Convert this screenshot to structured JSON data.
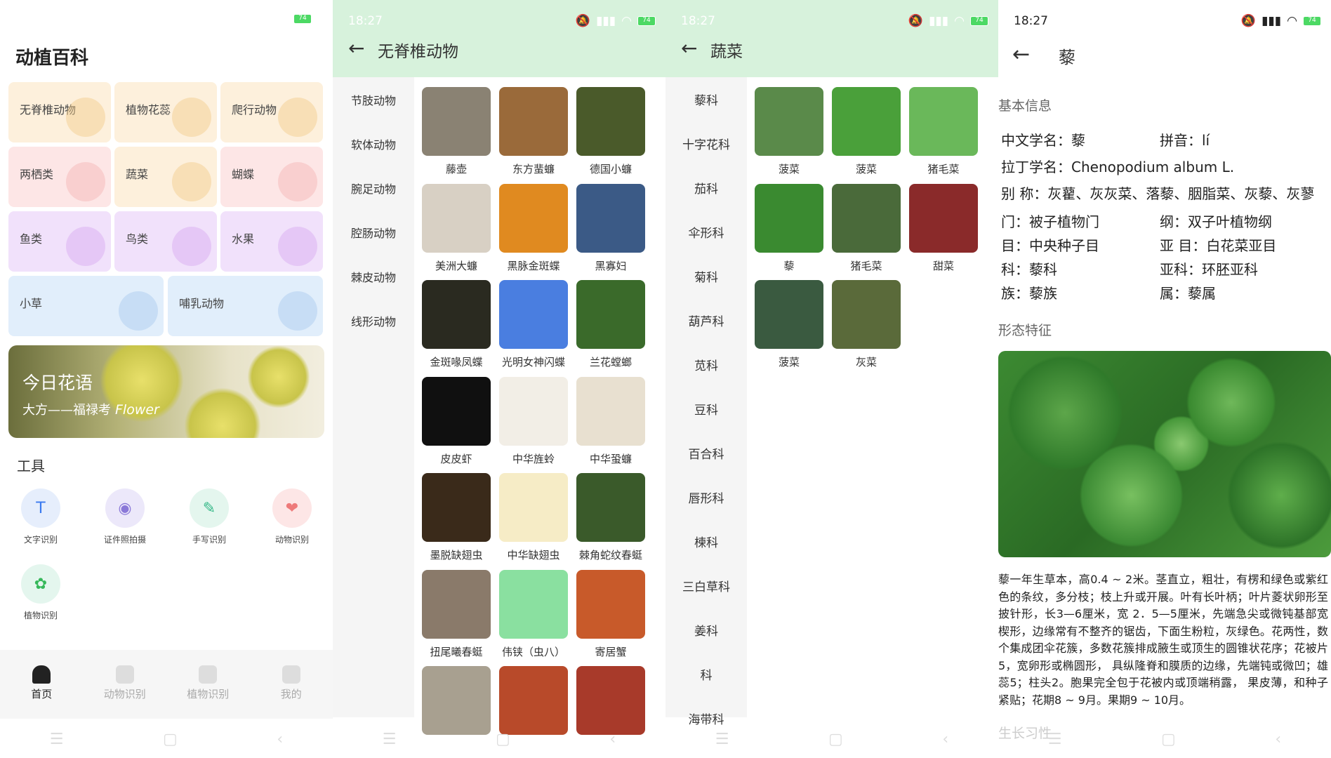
{
  "panel1": {
    "status": {
      "battery": "74"
    },
    "app_title": "动植百科",
    "tiles": [
      {
        "label": "无脊椎动物",
        "color": "#fdf0dc",
        "deco": "#f2c988"
      },
      {
        "label": "植物花蕊",
        "color": "#fdf0dc",
        "deco": "#f2c988"
      },
      {
        "label": "爬行动物",
        "color": "#fdf0dc",
        "deco": "#f2c988"
      },
      {
        "label": "两栖类",
        "color": "#fde6e6",
        "deco": "#f3b3b3"
      },
      {
        "label": "蔬菜",
        "color": "#fdf0dc",
        "deco": "#f2c988"
      },
      {
        "label": "蝴蝶",
        "color": "#fde6e6",
        "deco": "#f3b3b3"
      },
      {
        "label": "鱼类",
        "color": "#f1e1fb",
        "deco": "#d6a8f0"
      },
      {
        "label": "鸟类",
        "color": "#f1e1fb",
        "deco": "#d6a8f0"
      },
      {
        "label": "水果",
        "color": "#f1e1fb",
        "deco": "#d6a8f0"
      },
      {
        "label": "小草",
        "color": "#e1eefb",
        "deco": "#a8c8ee"
      },
      {
        "label": "哺乳动物",
        "color": "#e1eefb",
        "deco": "#a8c8ee"
      }
    ],
    "banner": {
      "title": "今日花语",
      "subtitle": "大方——福禄考",
      "subtitle_italic": "Flower"
    },
    "tools_title": "工具",
    "tools": [
      {
        "label": "文字识别",
        "icon": "text-recognition-icon",
        "bg": "#e6eefc",
        "fg": "#3a7af0",
        "glyph": "T"
      },
      {
        "label": "证件照拍摄",
        "icon": "camera-icon",
        "bg": "#ece8fa",
        "fg": "#8a78d8",
        "glyph": "◉"
      },
      {
        "label": "手写识别",
        "icon": "feather-icon",
        "bg": "#e4f6ee",
        "fg": "#36b888",
        "glyph": "✎"
      },
      {
        "label": "动物识别",
        "icon": "dog-icon",
        "bg": "#fde6e6",
        "fg": "#ee7a7a",
        "glyph": "❤"
      },
      {
        "label": "植物识别",
        "icon": "plant-pot-icon",
        "bg": "#e4f6ee",
        "fg": "#36b85a",
        "glyph": "✿"
      }
    ],
    "bottom_tabs": [
      {
        "label": "首页",
        "active": true
      },
      {
        "label": "动物识别",
        "active": false
      },
      {
        "label": "植物识别",
        "active": false
      },
      {
        "label": "我的",
        "active": false
      }
    ]
  },
  "panel2": {
    "time": "18:27",
    "battery": "74",
    "title": "无脊椎动物",
    "categories": [
      "节肢动物",
      "软体动物",
      "腕足动物",
      "腔肠动物",
      "棘皮动物",
      "线形动物"
    ],
    "items": [
      {
        "label": "藤壶",
        "color": "#8a8273"
      },
      {
        "label": "东方蜚蠊",
        "color": "#9a6a3a"
      },
      {
        "label": "德国小蠊",
        "color": "#4a5a2a"
      },
      {
        "label": "美洲大蠊",
        "color": "#d8d0c4"
      },
      {
        "label": "黑脉金斑蝶",
        "color": "#e08a20"
      },
      {
        "label": "黑寡妇",
        "color": "#3b5a86"
      },
      {
        "label": "金斑喙凤蝶",
        "color": "#2a2a20"
      },
      {
        "label": "光明女神闪蝶",
        "color": "#4a7ee0"
      },
      {
        "label": "兰花螳螂",
        "color": "#3a6a2a"
      },
      {
        "label": "皮皮虾",
        "color": "#101010"
      },
      {
        "label": "中华旌蛉",
        "color": "#f2eee6"
      },
      {
        "label": "中华蛩蠊",
        "color": "#e8e0d0"
      },
      {
        "label": "墨脱缺翅虫",
        "color": "#3a2a1a"
      },
      {
        "label": "中华缺翅虫",
        "color": "#f6ecc6"
      },
      {
        "label": "棘角蛇纹春蜓",
        "color": "#3a5a2a"
      },
      {
        "label": "扭尾曦春蜓",
        "color": "#8a7a6a"
      },
      {
        "label": "伟铗（虫八）",
        "color": "#8ae0a0"
      },
      {
        "label": "寄居蟹",
        "color": "#c85a2a"
      },
      {
        "label": "",
        "color": "#a8a090"
      },
      {
        "label": "",
        "color": "#b84a2a"
      },
      {
        "label": "",
        "color": "#a83a2a"
      }
    ]
  },
  "panel3": {
    "time": "18:27",
    "battery": "74",
    "title": "蔬菜",
    "categories": [
      "藜科",
      "十字花科",
      "茄科",
      "伞形科",
      "菊科",
      "葫芦科",
      "苋科",
      "豆科",
      "百合科",
      "唇形科",
      "楝科",
      "三白草科",
      "姜科",
      "科",
      "海带科"
    ],
    "items": [
      {
        "label": "菠菜",
        "color": "#5a8a4a"
      },
      {
        "label": "菠菜",
        "color": "#4aa03a"
      },
      {
        "label": "猪毛菜",
        "color": "#6ab85a"
      },
      {
        "label": "藜",
        "color": "#3a8a30"
      },
      {
        "label": "猪毛菜",
        "color": "#4a6a3a"
      },
      {
        "label": "甜菜",
        "color": "#8a2a2a"
      },
      {
        "label": "菠菜",
        "color": "#3a5a40"
      },
      {
        "label": "灰菜",
        "color": "#5a6a3a"
      }
    ]
  },
  "panel4": {
    "time": "18:27",
    "battery": "74",
    "title": "藜",
    "basic_title": "基本信息",
    "info_rows": [
      {
        "a": "中文学名：藜",
        "b": "拼音：lí"
      },
      {
        "a": "拉丁学名：Chenopodium album L.",
        "b": ""
      },
      {
        "a": "别 称：灰藋、灰灰菜、落藜、胭脂菜、灰藜、灰蓼",
        "b": ""
      },
      {
        "a": "门：被子植物门",
        "b": "纲：双子叶植物纲"
      },
      {
        "a": "目：中央种子目",
        "b": "亚 目：白花菜亚目"
      },
      {
        "a": "科：藜科",
        "b": "亚科：环胚亚科"
      },
      {
        "a": "族：藜族",
        "b": "属：藜属"
      }
    ],
    "morph_title": "形态特征",
    "description": "藜一年生草本，高0.4 ~ 2米。茎直立，粗壮，有楞和绿色或紫红色的条纹，多分枝；枝上升或开展。叶有长叶柄；叶片菱状卵形至披针形，长3—6厘米，宽 2．5—5厘米，先端急尖或微钝基部宽楔形，边缘常有不整齐的锯齿，下面生粉粒，灰绿色。花两性，数个集成团伞花簇，多数花簇排成腋生或顶生的圆锥状花序；花被片5，宽卵形或椭圆形， 具纵隆脊和膜质的边缘，先端钝或微凹；雄蕊5；柱头2。胞果完全包于花被内或顶端稍露， 果皮薄，和种子紧贴；花期8 ~ 9月。果期9 ~ 10月。",
    "next_title": "生长习性"
  }
}
